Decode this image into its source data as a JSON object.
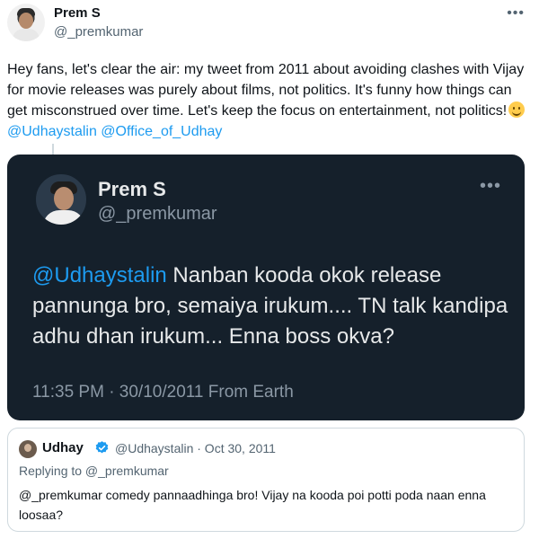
{
  "author": {
    "name": "Prem S",
    "handle": "@_premkumar",
    "more_icon": "ellipsis-icon"
  },
  "tweet": {
    "text_main": "Hey fans, let's clear the air: my tweet from 2011 about avoiding clashes with Vijay for movie releases was purely about films, not politics. It's funny how things can get misconstrued over time. Let's keep the focus on entertainment, not politics!",
    "emoji": "slightly-smiling-face-emoji",
    "mention_1": "@Udhaystalin",
    "mention_2": "@Office_of_Udhay"
  },
  "old_tweet": {
    "name": "Prem S",
    "handle": "@_premkumar",
    "mention": "@Udhaystalin",
    "text": " Nanban kooda okok release pannunga bro, semaiya irukum.... TN talk kandipa adhu dhan irukum... Enna boss okva?",
    "meta": "11:35 PM · 30/10/2011 From Earth",
    "background": "#15202b"
  },
  "quoted_reply": {
    "name": "Udhay",
    "verified_icon": "verified-badge-icon",
    "handle_date": "@Udhaystalin · Oct 30, 2011",
    "replying_to": "Replying to @_premkumar",
    "text": "@_premkumar comedy pannaadhinga bro! Vijay na kooda poi potti poda naan enna loosaa?"
  },
  "colors": {
    "accent": "#1d9bf0",
    "text": "#0f1419",
    "muted": "#536471",
    "dark_card": "#15202b"
  }
}
